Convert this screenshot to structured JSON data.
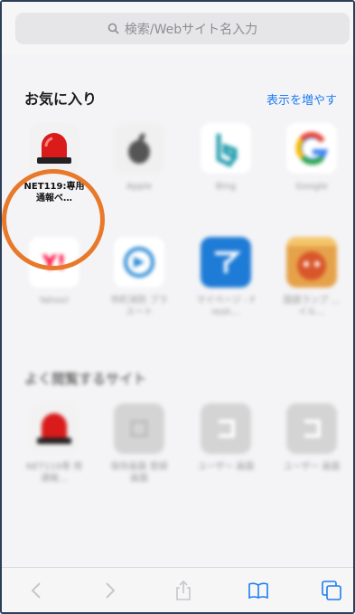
{
  "search": {
    "placeholder": "検索/Webサイト名入力"
  },
  "favorites": {
    "title": "お気に入り",
    "more": "表示を増やす",
    "items": [
      {
        "label": "NET119:専用通報ベ…",
        "icon": "siren-icon"
      },
      {
        "label": "Apple",
        "icon": "apple-icon"
      },
      {
        "label": "Bing",
        "icon": "bing-icon"
      },
      {
        "label": "Google",
        "icon": "google-icon"
      },
      {
        "label": "Yahoo!",
        "icon": "yahoo-icon"
      },
      {
        "label": "市町消防 ブラスート",
        "icon": "circle-logo-icon"
      },
      {
        "label": "マイページ - Fresh…",
        "icon": "blue-logo-icon"
      },
      {
        "label": "国語ランプ …イル…",
        "icon": "anime-thumb-icon"
      }
    ]
  },
  "frequent": {
    "title": "よく閲覧するサイト",
    "items": [
      {
        "label": "NET119専 用通報…",
        "icon": "siren-icon"
      },
      {
        "label": "保存画面 登録画面",
        "icon": "placeholder-icon"
      },
      {
        "label": "ユーザー 画面",
        "icon": "letter-u-icon"
      },
      {
        "label": "ユーザー 画面",
        "icon": "letter-u-icon"
      }
    ]
  },
  "colors": {
    "accent": "#1f7cf2",
    "highlight_ring": "#e8792b",
    "siren_red": "#d91b1b"
  }
}
